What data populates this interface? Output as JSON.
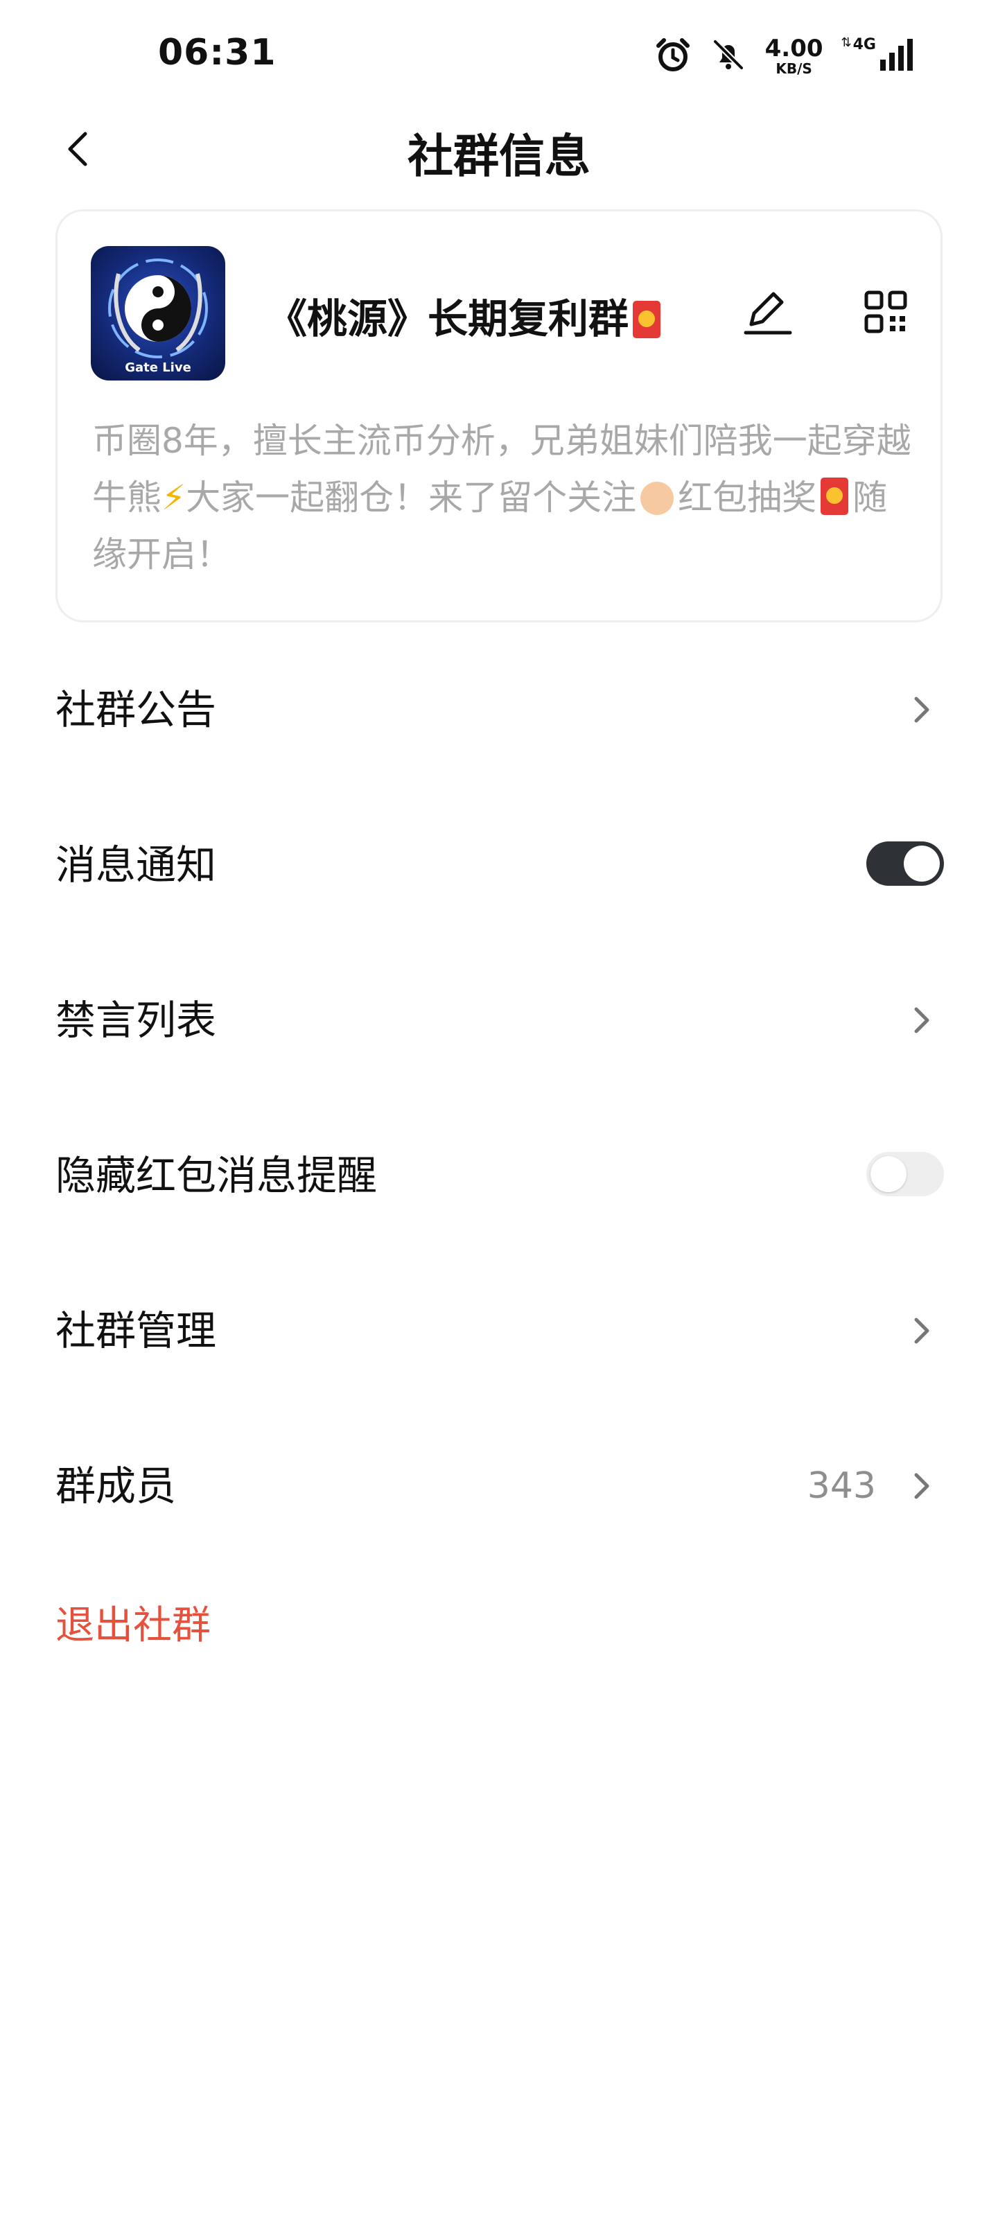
{
  "status_bar": {
    "time": "06:31",
    "speed_value": "4.00",
    "speed_unit": "KB/S",
    "network": "4G"
  },
  "header": {
    "title": "社群信息"
  },
  "group": {
    "avatar_label": "Gate Live",
    "name": "《桃源》长期复利群",
    "description_parts": {
      "p1": "币圈8年，擅长主流币分析，兄弟姐妹们陪我一起穿越牛熊",
      "p2": "大家一起翻仓！来了留个关注",
      "p3": "红包抽奖",
      "p4": "随缘开启！"
    }
  },
  "settings": {
    "announcement": "社群公告",
    "notifications": "消息通知",
    "notifications_on": true,
    "mute_list": "禁言列表",
    "hide_redpacket": "隐藏红包消息提醒",
    "hide_redpacket_on": false,
    "management": "社群管理",
    "members": "群成员",
    "member_count": "343"
  },
  "exit_label": "退出社群",
  "colors": {
    "accent_red": "#e5513c",
    "toggle_on": "#2e3135",
    "toggle_off": "#eeeeee"
  }
}
